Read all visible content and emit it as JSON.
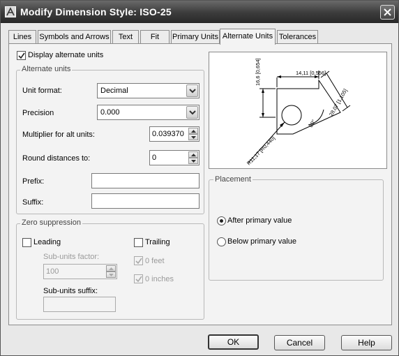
{
  "window": {
    "title": "Modify Dimension Style: ISO-25"
  },
  "tabs": [
    {
      "label": "Lines"
    },
    {
      "label": "Symbols and Arrows"
    },
    {
      "label": "Text"
    },
    {
      "label": "Fit"
    },
    {
      "label": "Primary Units"
    },
    {
      "label": "Alternate Units",
      "active": true
    },
    {
      "label": "Tolerances"
    }
  ],
  "display_alt_units": {
    "label": "Display alternate units",
    "checked": true
  },
  "alternate_units": {
    "group_title": "Alternate units",
    "unit_format": {
      "label": "Unit format:",
      "value": "Decimal"
    },
    "precision": {
      "label": "Precision",
      "value": "0.000"
    },
    "multiplier": {
      "label": "Multiplier for alt units:",
      "value": "0.039370"
    },
    "round": {
      "label": "Round distances  to:",
      "value": "0"
    },
    "prefix": {
      "label": "Prefix:",
      "value": ""
    },
    "suffix": {
      "label": "Suffix:",
      "value": ""
    }
  },
  "zero_suppression": {
    "group_title": "Zero suppression",
    "leading": {
      "label": "Leading",
      "checked": false
    },
    "sub_units_factor": {
      "label": "Sub-units factor:",
      "value": "100"
    },
    "sub_units_suffix": {
      "label": "Sub-units suffix:",
      "value": ""
    },
    "trailing": {
      "label": "Trailing",
      "checked": false
    },
    "zero_feet": {
      "label": "0 feet",
      "checked": true,
      "disabled": true
    },
    "zero_inches": {
      "label": "0 inches",
      "checked": true,
      "disabled": true
    }
  },
  "preview": {
    "dim_top": "14,11 [0,556]",
    "dim_left": "16,6 [0,654]",
    "dim_right": "28,07 [1,105]",
    "dim_angle": "80°",
    "dim_radius": "R11,17 [R0,440]"
  },
  "placement": {
    "group_title": "Placement",
    "after": {
      "label": "After primary value",
      "selected": true
    },
    "below": {
      "label": "Below primary value",
      "selected": false
    }
  },
  "buttons": {
    "ok": "OK",
    "cancel": "Cancel",
    "help": "Help"
  }
}
